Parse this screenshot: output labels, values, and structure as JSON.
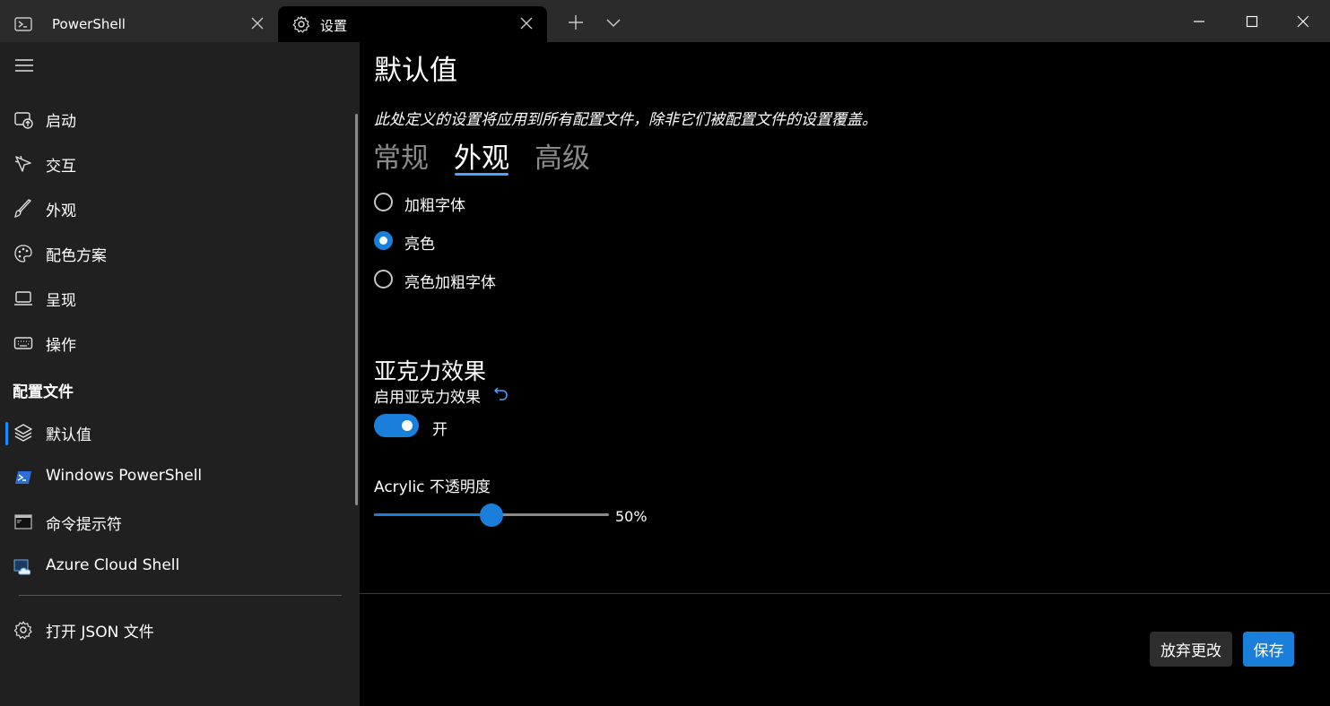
{
  "titlebar": {
    "tabs": [
      {
        "title": "PowerShell",
        "icon": "powershell-icon"
      },
      {
        "title": "设置",
        "icon": "gear-icon"
      }
    ],
    "new_tab_icon": "plus-icon",
    "dropdown_icon": "chevron-down-icon",
    "window_controls": [
      "minimize-icon",
      "maximize-icon",
      "close-icon"
    ]
  },
  "sidebar": {
    "menu_icon": "hamburger-icon",
    "items": [
      {
        "label": "启动",
        "icon": "startup-icon"
      },
      {
        "label": "交互",
        "icon": "pointer-icon"
      },
      {
        "label": "外观",
        "icon": "brush-icon"
      },
      {
        "label": "配色方案",
        "icon": "palette-icon"
      },
      {
        "label": "呈现",
        "icon": "monitor-icon"
      },
      {
        "label": "操作",
        "icon": "keyboard-icon"
      }
    ],
    "profiles_header": "配置文件",
    "profiles": [
      {
        "label": "默认值",
        "icon": "layers-icon",
        "selected": true
      },
      {
        "label": "Windows PowerShell",
        "icon": "powershell-icon"
      },
      {
        "label": "命令提示符",
        "icon": "cmd-icon"
      },
      {
        "label": "Azure Cloud Shell",
        "icon": "azure-cloud-icon"
      }
    ],
    "open_json": {
      "label": "打开 JSON 文件",
      "icon": "gear-icon"
    }
  },
  "main": {
    "title": "默认值",
    "description": "此处定义的设置将应用到所有配置文件，除非它们被配置文件的设置覆盖。",
    "pivots": [
      {
        "label": "常规",
        "active": false
      },
      {
        "label": "外观",
        "active": true
      },
      {
        "label": "高级",
        "active": false
      }
    ],
    "radio_options": [
      {
        "label": "加粗字体",
        "checked": false
      },
      {
        "label": "亮色",
        "checked": true
      },
      {
        "label": "亮色加粗字体",
        "checked": false
      }
    ],
    "acrylic": {
      "section_title": "亚克力效果",
      "enable_label": "启用亚克力效果",
      "reset_icon": "reset-icon",
      "toggle_state": "开",
      "toggle_on": true,
      "opacity_label": "Acrylic 不透明度",
      "opacity_value": 50,
      "opacity_text": "50%"
    },
    "footer": {
      "discard_label": "放弃更改",
      "save_label": "保存"
    }
  },
  "colors": {
    "accent": "#1a7fdb",
    "sidebar_bg": "#202020",
    "titlebar_bg": "#2b2b2b",
    "content_bg": "#000000"
  }
}
